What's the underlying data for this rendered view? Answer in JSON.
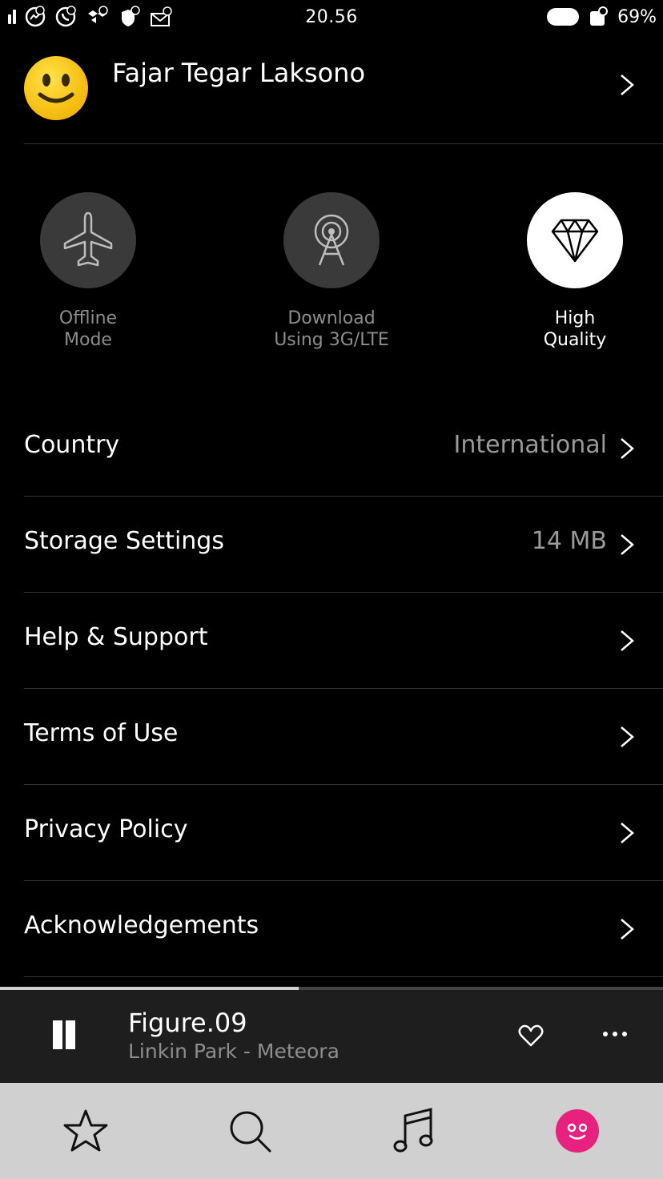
{
  "status_bar": {
    "time": "20.56",
    "battery": "69%",
    "notification_icons": [
      "messenger-icon",
      "whatsapp-icon",
      "dropbox-icon",
      "shield-icon",
      "mail-icon"
    ]
  },
  "profile": {
    "name": "Fajar Tegar Laksono",
    "avatar": "smiley-avatar"
  },
  "quick_toggles": [
    {
      "label": "Offline\nMode",
      "icon": "airplane-icon",
      "active": false
    },
    {
      "label": "Download\nUsing 3G/LTE",
      "icon": "antenna-icon",
      "active": false
    },
    {
      "label": "High\nQuality",
      "icon": "diamond-icon",
      "active": true
    }
  ],
  "settings": [
    {
      "label": "Country",
      "value": "International"
    },
    {
      "label": "Storage Settings",
      "value": "14 MB"
    },
    {
      "label": "Help & Support",
      "value": ""
    },
    {
      "label": "Terms of Use",
      "value": ""
    },
    {
      "label": "Privacy Policy",
      "value": ""
    },
    {
      "label": "Acknowledgements",
      "value": ""
    }
  ],
  "player": {
    "title": "Figure.09",
    "subtitle": "Linkin Park - Meteora",
    "progress": 0.45
  },
  "bottom_nav": {
    "items": [
      "favorites",
      "search",
      "music",
      "profile"
    ],
    "active": "profile",
    "accent_color": "#e8217e"
  }
}
